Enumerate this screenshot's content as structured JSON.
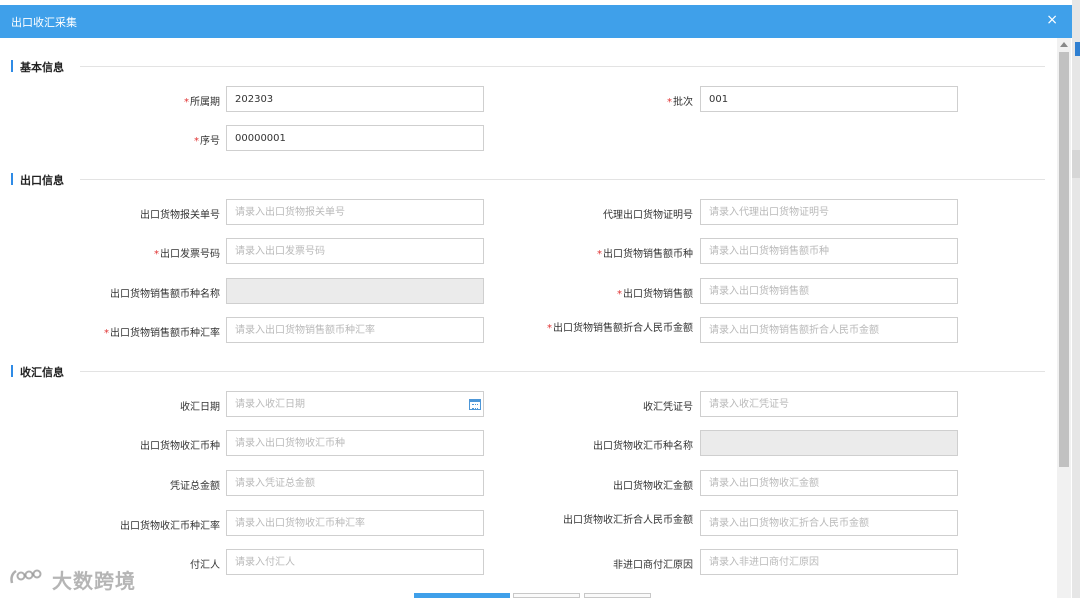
{
  "dialog": {
    "title": "出口收汇采集",
    "close_icon": "×"
  },
  "sections": {
    "basic": "基本信息",
    "export": "出口信息",
    "receipt": "收汇信息"
  },
  "fields": {
    "period": {
      "label": "所属期",
      "value": "202303",
      "required": true
    },
    "batch": {
      "label": "批次",
      "value": "001",
      "required": true
    },
    "seq": {
      "label": "序号",
      "value": "00000001",
      "required": true
    },
    "customs_no": {
      "label": "出口货物报关单号",
      "placeholder": "请录入出口货物报关单号"
    },
    "agent_cert": {
      "label": "代理出口货物证明号",
      "placeholder": "请录入代理出口货物证明号"
    },
    "invoice_no": {
      "label": "出口发票号码",
      "placeholder": "请录入出口发票号码",
      "required": true
    },
    "sales_currency": {
      "label": "出口货物销售额币种",
      "placeholder": "请录入出口货物销售额币种",
      "required": true
    },
    "sales_currency_name": {
      "label": "出口货物销售额币种名称",
      "value": ""
    },
    "sales_amount": {
      "label": "出口货物销售额",
      "placeholder": "请录入出口货物销售额",
      "required": true
    },
    "sales_rate": {
      "label": "出口货物销售额币种汇率",
      "placeholder": "请录入出口货物销售额币种汇率",
      "required": true
    },
    "sales_rmb": {
      "label": "出口货物销售额折合人民币金额",
      "placeholder": "请录入出口货物销售额折合人民币金额",
      "required": true
    },
    "receipt_date": {
      "label": "收汇日期",
      "placeholder": "请录入收汇日期"
    },
    "receipt_voucher": {
      "label": "收汇凭证号",
      "placeholder": "请录入收汇凭证号"
    },
    "receipt_currency": {
      "label": "出口货物收汇币种",
      "placeholder": "请录入出口货物收汇币种"
    },
    "receipt_currency_name": {
      "label": "出口货物收汇币种名称",
      "value": ""
    },
    "voucher_total": {
      "label": "凭证总金额",
      "placeholder": "请录入凭证总金额"
    },
    "receipt_amount": {
      "label": "出口货物收汇金额",
      "placeholder": "请录入出口货物收汇金额"
    },
    "receipt_rate": {
      "label": "出口货物收汇币种汇率",
      "placeholder": "请录入出口货物收汇币种汇率"
    },
    "receipt_rmb": {
      "label": "出口货物收汇折合人民币金额",
      "placeholder": "请录入出口货物收汇折合人民币金额"
    },
    "payer": {
      "label": "付汇人",
      "placeholder": "请录入付汇人"
    },
    "non_import_reason": {
      "label": "非进口商付汇原因",
      "placeholder": "请录入非进口商付汇原因"
    }
  },
  "watermark": {
    "text": "大数跨境"
  },
  "colors": {
    "accent": "#3fa0ea",
    "required": "#e03131",
    "section_bar": "#2f8be6"
  },
  "icons": {
    "close": "close-icon",
    "calendar": "calendar-icon"
  }
}
